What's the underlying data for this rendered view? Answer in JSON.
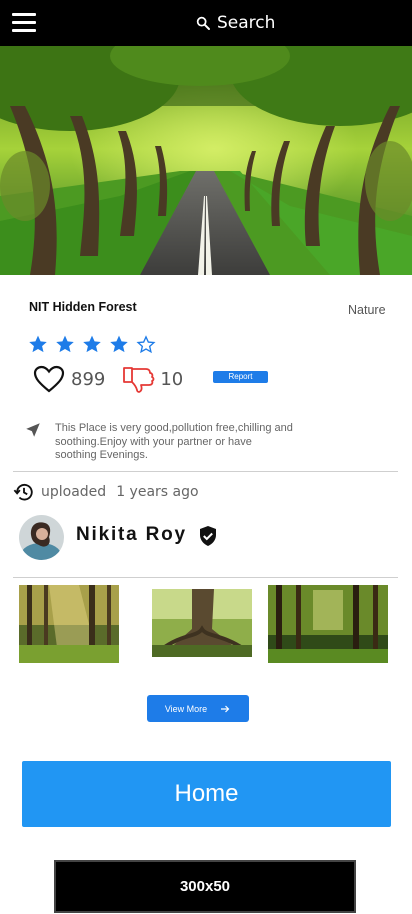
{
  "header": {
    "search_label": "Search",
    "menu_icon": "hamburger-menu-icon",
    "search_icon": "search-icon"
  },
  "place": {
    "name": "NIT Hidden Forest",
    "category": "Nature",
    "rating": 4,
    "rating_max": 5,
    "likes": "899",
    "dislikes": "10",
    "report_label": "Report",
    "description": "This Place is very good,pollution free,chilling and soothing.Enjoy with your partner or have soothing Evenings."
  },
  "upload": {
    "label": "uploaded",
    "time": "1 years ago"
  },
  "user": {
    "name": "Nikita Roy"
  },
  "actions": {
    "view_more_label": "View More",
    "home_label": "Home"
  },
  "ad": {
    "label": "300x50"
  },
  "colors": {
    "accent": "#1e7ce8",
    "home_button": "#2196f3",
    "star": "#1e7ce8",
    "dislike": "#e53935"
  }
}
